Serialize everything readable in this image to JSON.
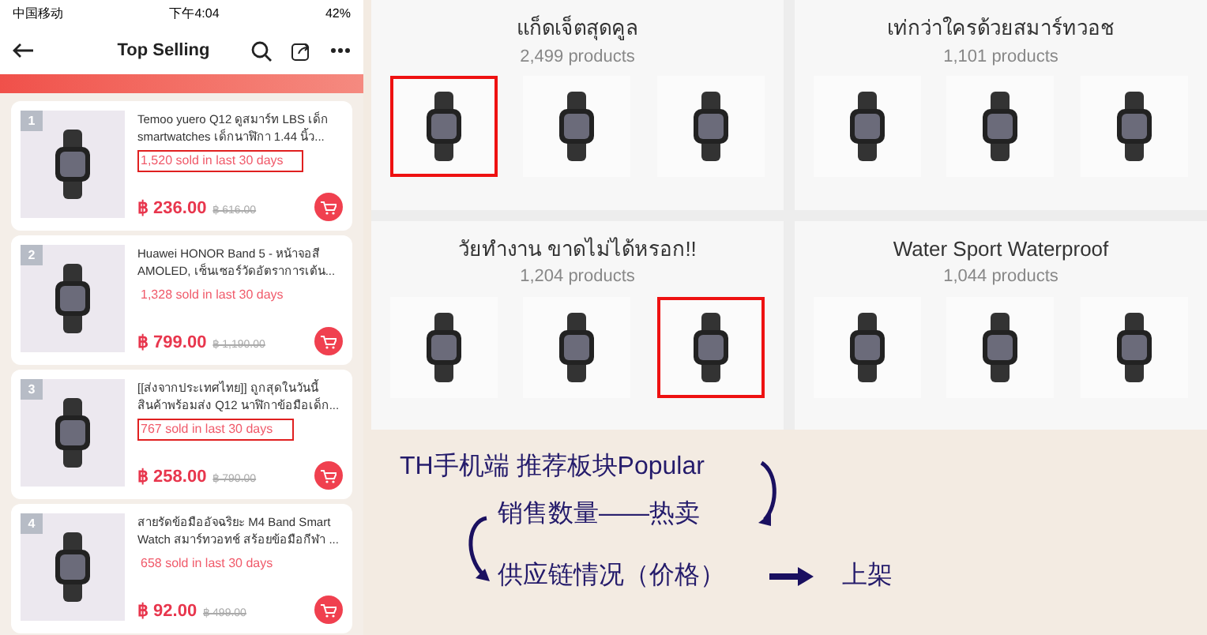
{
  "phone": {
    "status_bar": {
      "carrier": "中国移动",
      "time": "下午4:04",
      "battery": "42%"
    },
    "header": {
      "title": "Top Selling"
    },
    "products": [
      {
        "rank": "1",
        "title": "Temoo yuero Q12 ดูสมาร์ท LBS เด็ก smartwatches เด็กนาฬิกา 1.44 นิ้ว...",
        "sold": "1,520 sold in last 30 days",
        "highlighted": true,
        "price": "฿ 236.00",
        "old_price": "฿ 616.00"
      },
      {
        "rank": "2",
        "title": "Huawei HONOR Band 5 - หน้าจอสี AMOLED, เซ็นเซอร์วัดอัตราการเต้น...",
        "sold": "1,328 sold in last 30 days",
        "highlighted": false,
        "price": "฿ 799.00",
        "old_price": "฿ 1,190.00"
      },
      {
        "rank": "3",
        "title": "[[ส่งจากประเทศไทย]] ถูกสุดในวันนี้ สินค้าพร้อมส่ง Q12 นาฬิกาข้อมือเด็ก...",
        "sold": "767 sold in last 30 days",
        "highlighted": true,
        "price": "฿ 258.00",
        "old_price": "฿ 790.00"
      },
      {
        "rank": "4",
        "title": "สายรัดข้อมืออัจฉริยะ M4 Band Smart Watch สมาร์ทวอทช์ สร้อยข้อมือกีฬา ...",
        "sold": "658 sold in last 30 days",
        "highlighted": false,
        "price": "฿ 92.00",
        "old_price": "฿ 499.00"
      }
    ]
  },
  "categories": [
    {
      "title": "แก็ดเจ็ตสุดคูล",
      "count": "2,499 products",
      "images": [
        {
          "highlighted": true
        },
        {
          "highlighted": false
        },
        {
          "highlighted": false
        }
      ]
    },
    {
      "title": "เท่กว่าใครด้วยสมาร์ทวอช",
      "count": "1,101 products",
      "images": [
        {
          "highlighted": false
        },
        {
          "highlighted": false
        },
        {
          "highlighted": false
        }
      ]
    },
    {
      "title": "วัยทำงาน ขาดไม่ได้หรอก!!",
      "count": "1,204 products",
      "images": [
        {
          "highlighted": false
        },
        {
          "highlighted": false
        },
        {
          "highlighted": true
        }
      ]
    },
    {
      "title": "Water Sport Waterproof",
      "count": "1,044 products",
      "images": [
        {
          "highlighted": false
        },
        {
          "highlighted": false
        },
        {
          "highlighted": false
        }
      ]
    }
  ],
  "notes": {
    "line_1": "TH手机端 推荐板块Popular",
    "line_2": "销售数量——热卖",
    "line_3": "供应链情况（价格）",
    "line_4": "上架"
  }
}
